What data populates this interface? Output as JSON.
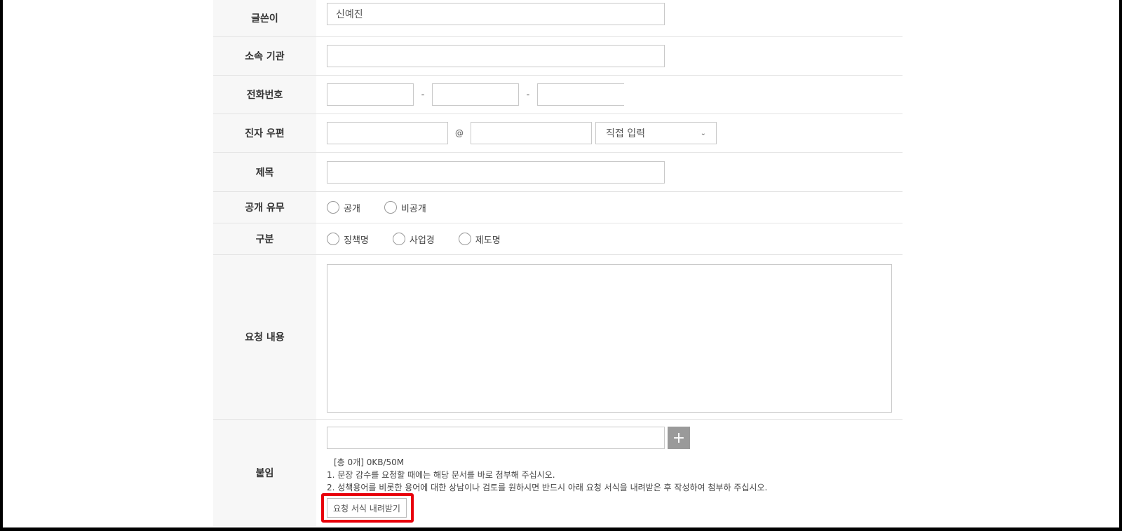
{
  "form": {
    "author": {
      "label": "글쓴이",
      "value": "신예진"
    },
    "org": {
      "label": "소속 기관",
      "value": ""
    },
    "phone": {
      "label": "전화번호",
      "sep1": "-",
      "sep2": "-"
    },
    "email": {
      "label": "진자 우편",
      "at": "@",
      "domain_select": "직접 입력"
    },
    "title": {
      "label": "제목",
      "value": ""
    },
    "public": {
      "label": "공개 유무",
      "options": [
        "공개",
        "비공개"
      ]
    },
    "category": {
      "label": "구분",
      "options": [
        "징책명",
        "사업경",
        "제도명"
      ]
    },
    "content": {
      "label": "요청 내용"
    },
    "attach": {
      "label": "붙임",
      "count_text": "[총 0개] 0KB/50M",
      "note1": "1. 문장 감수를 요청할 때에는 해당 문서를 바로 첨부해 주십시오.",
      "note2": "2. 성책용어를 비롯한 용어에 대한 상남이나 검토를 원하시면 반드시 아래 요청 서식을 내려받은 후 작성하여 첨부하 주십시오.",
      "download_label": "요청 서식 내려받기"
    }
  },
  "colors": {
    "label_bg": "#f7f7f7",
    "border": "#c9c9c9",
    "plus_btn": "#9a9a9a",
    "highlight": "#e8000b"
  },
  "icons": {
    "plus": "plus-icon",
    "select_arrow": "chevron-down-icon"
  }
}
